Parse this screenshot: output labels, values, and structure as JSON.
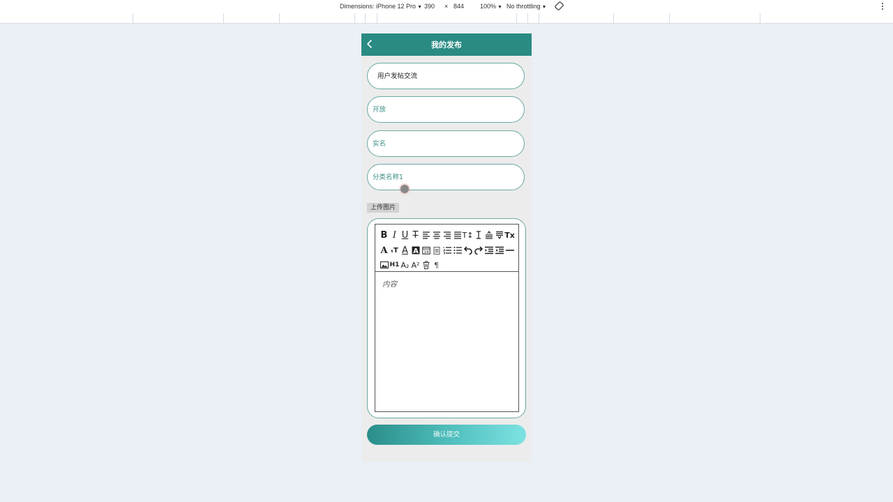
{
  "devtools": {
    "dimensions_label": "Dimensions: iPhone 12 Pro",
    "width": "390",
    "times": "×",
    "height": "844",
    "zoom": "100%",
    "throttling": "No throttling"
  },
  "header": {
    "title": "我的发布"
  },
  "form": {
    "field1_value": "用户发帖交流",
    "field2_value": "开放",
    "field3_value": "实名",
    "field4_value": "分类名称1"
  },
  "upload": {
    "label": "上传图片"
  },
  "editor": {
    "placeholder": "内容",
    "toolbar_rows": [
      [
        "bold",
        "italic",
        "underline",
        "strikethrough",
        "align-left",
        "align-center",
        "align-right",
        "align-justify",
        "font-size",
        "line-height",
        "letter-spacing",
        "paragraph-spacing",
        "clear-format"
      ],
      [
        "font-color",
        "font-size-small",
        "text-underline-color",
        "background-color",
        "date",
        "clipboard",
        "ordered-list",
        "unordered-list",
        "undo",
        "redo",
        "indent",
        "outdent",
        "horizontal-rule"
      ],
      [
        "image",
        "heading-h1",
        "subscript",
        "superscript",
        "delete",
        "pilcrow"
      ]
    ]
  },
  "submit": {
    "label": "确认提交"
  },
  "colors": {
    "accent": "#2a8a84",
    "field_border": "#6aa8a3",
    "placeholder": "#3b8e86"
  }
}
